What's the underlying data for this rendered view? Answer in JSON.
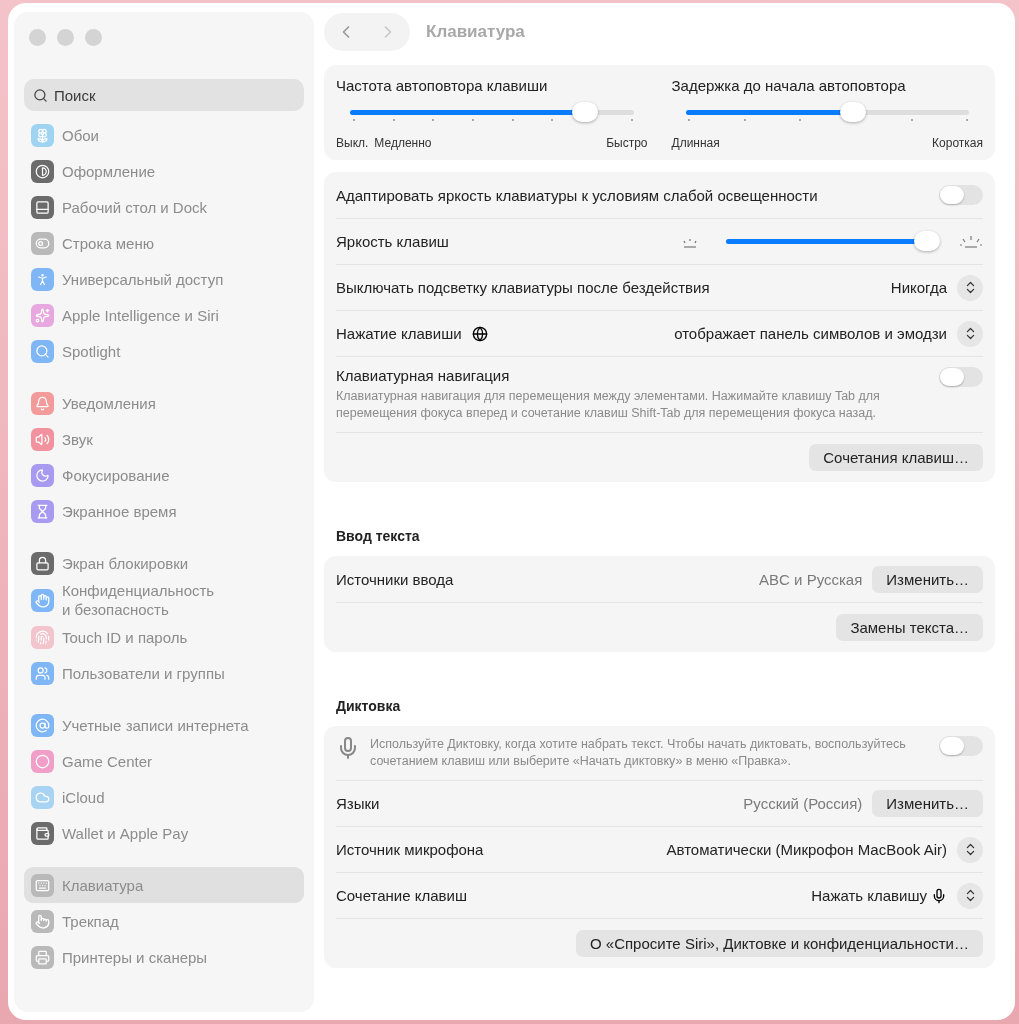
{
  "sidebar": {
    "search": {
      "placeholder": "Поиск"
    },
    "groups": [
      {
        "items": [
          {
            "label": "Обои",
            "color": "#9fd3f2",
            "selected": false
          },
          {
            "label": "Оформление",
            "color": "#6b6b6b",
            "selected": false
          },
          {
            "label": "Рабочий стол и Dock",
            "color": "#6b6b6b",
            "selected": false
          },
          {
            "label": "Строка меню",
            "color": "#b9b9b9",
            "selected": false
          },
          {
            "label": "Универсальный доступ",
            "color": "#7fb6f5",
            "selected": false
          },
          {
            "label": "Apple Intelligence и Siri",
            "color": "#e7a8e0",
            "selected": false
          },
          {
            "label": "Spotlight",
            "color": "#7fb6f5",
            "selected": false
          }
        ]
      },
      {
        "items": [
          {
            "label": "Уведомления",
            "color": "#f39a9a",
            "selected": false
          },
          {
            "label": "Звук",
            "color": "#f3929f",
            "selected": false
          },
          {
            "label": "Фокусирование",
            "color": "#a89af0",
            "selected": false
          },
          {
            "label": "Экранное время",
            "color": "#a89af0",
            "selected": false
          }
        ]
      },
      {
        "items": [
          {
            "label": "Экран блокировки",
            "color": "#6b6b6b",
            "selected": false
          },
          {
            "label": "Конфиденциальность\nи безопасность",
            "color": "#7fb6f5",
            "selected": false
          },
          {
            "label": "Touch ID и пароль",
            "color": "#f2c4cc",
            "selected": false
          },
          {
            "label": "Пользователи и группы",
            "color": "#7fb6f5",
            "selected": false
          }
        ]
      },
      {
        "items": [
          {
            "label": "Учетные записи интернета",
            "color": "#7fb6f5",
            "selected": false
          },
          {
            "label": "Game Center",
            "color": "#f0a0c8",
            "selected": false
          },
          {
            "label": "iCloud",
            "color": "#a9d3f3",
            "selected": false
          },
          {
            "label": "Wallet и Apple Pay",
            "color": "#6b6b6b",
            "selected": false
          }
        ]
      },
      {
        "items": [
          {
            "label": "Клавиатура",
            "color": "#b9b9b9",
            "selected": true
          },
          {
            "label": "Трекпад",
            "color": "#b9b9b9",
            "selected": false
          },
          {
            "label": "Принтеры и сканеры",
            "color": "#b9b9b9",
            "selected": false
          }
        ]
      }
    ]
  },
  "toolbar": {
    "title": "Клавиатура"
  },
  "sections": [
    {
      "kind": "sliders",
      "sliders": [
        {
          "label": "Частота автоповтора клавиши",
          "level": 0.83,
          "left_labels": [
            "Выкл.",
            "Медленно"
          ],
          "right_label": "Быстро"
        },
        {
          "label": "Задержка до начала автоповтора",
          "level": 0.59,
          "left_labels": [
            "Длинная"
          ],
          "right_label": "Короткая"
        }
      ]
    },
    {
      "kind": "rows",
      "rows": [
        {
          "kind": "toggle",
          "label": "Адаптировать яркость клавиатуры к условиям слабой освещенности",
          "on": false
        },
        {
          "kind": "slider",
          "label": "Яркость клавиш",
          "level": 0.96
        },
        {
          "kind": "select",
          "label": "Выключать подсветку клавиатуры после бездействия",
          "value": "Никогда"
        },
        {
          "kind": "key-select",
          "label": "Нажатие клавиши",
          "value": "отображает панель символов и эмодзи"
        },
        {
          "kind": "toggle",
          "label": "Клавиатурная навигация",
          "description": "Клавиатурная навигация для перемещения между элементами. Нажимайте клавишу Tab для перемещения фокуса вперед и сочетание клавиш Shift-Tab для перемещения фокуса назад.",
          "on": false
        },
        {
          "kind": "buttons",
          "buttons": [
            "Сочетания клавиш…"
          ]
        }
      ]
    },
    {
      "kind": "rows",
      "heading": "Ввод текста",
      "rows": [
        {
          "kind": "value-button",
          "label": "Источники ввода",
          "value": "ABC и Русская",
          "button": "Изменить…"
        },
        {
          "kind": "buttons",
          "buttons": [
            "Замены текста…"
          ]
        }
      ]
    },
    {
      "kind": "rows",
      "heading": "Диктовка",
      "rows": [
        {
          "kind": "mic-toggle",
          "description": "Используйте Диктовку, когда хотите набрать текст. Чтобы начать диктовать, воспользуйтесь сочетанием клавиш или выберите «Начать диктовку» в меню «Правка».",
          "on": false
        },
        {
          "kind": "value-button",
          "label": "Языки",
          "value": "Русский (Россия)",
          "button": "Изменить…"
        },
        {
          "kind": "select",
          "label": "Источник микрофона",
          "value": "Автоматически (Микрофон MacBook Air)"
        },
        {
          "kind": "mic-select",
          "label": "Сочетание клавиш",
          "value": "Нажать клавишу"
        },
        {
          "kind": "buttons",
          "buttons": [
            "О «Спросите Siri», Диктовке и конфиденциальности…"
          ]
        }
      ]
    }
  ]
}
